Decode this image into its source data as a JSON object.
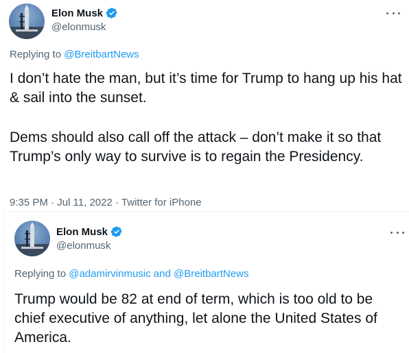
{
  "tweet1": {
    "author_name": "Elon Musk",
    "author_handle": "@elonmusk",
    "replying_prefix": "Replying to ",
    "replying_mentions": [
      "@BreitbartNews"
    ],
    "body_paragraph1": "I don’t hate the man, but it’s time for Trump to hang up his hat & sail into the sunset.",
    "body_paragraph2": "Dems should also call off the attack – don’t make it so that Trump’s only way to survive is to regain the Presidency.",
    "time": "9:35 PM",
    "date": "Jul 11, 2022",
    "source": "Twitter for iPhone",
    "separator": "·"
  },
  "tweet2": {
    "author_name": "Elon Musk",
    "author_handle": "@elonmusk",
    "replying_prefix": "Replying to ",
    "replying_mentions": [
      "@adamirvinmusic",
      "@BreitbartNews"
    ],
    "replying_joiner": " and ",
    "body": "Trump would be 82 at end of term, which is too old to be chief executive of anything, let alone the United States of America."
  },
  "colors": {
    "text": "#0f1419",
    "secondary": "#536471",
    "link": "#1d9bf0",
    "verified": "#1d9bf0"
  },
  "icons": {
    "verified": "verified-badge-icon",
    "more": "more-options-icon"
  }
}
